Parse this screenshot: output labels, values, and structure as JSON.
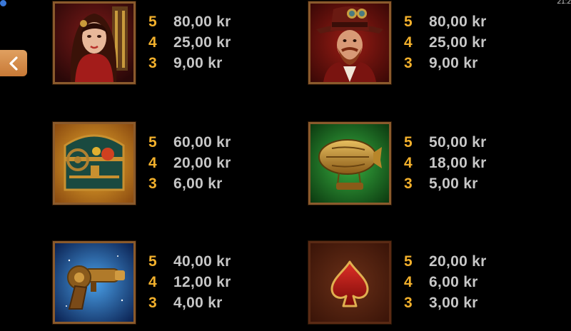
{
  "status_bar": {
    "time": "21:2"
  },
  "navigation": {
    "back_icon": "chevron-left-icon"
  },
  "theme": {
    "count_color": "#f2b02c",
    "amount_color": "#c6c6c6",
    "frame_color": "#8a5a2c",
    "back_button_color": "#d08a48"
  },
  "paytable": [
    {
      "symbol": "woman-character",
      "payouts": [
        {
          "count": "5",
          "amount": "80,00 kr"
        },
        {
          "count": "4",
          "amount": "25,00 kr"
        },
        {
          "count": "3",
          "amount": "9,00 kr"
        }
      ]
    },
    {
      "symbol": "man-character",
      "payouts": [
        {
          "count": "5",
          "amount": "80,00 kr"
        },
        {
          "count": "4",
          "amount": "25,00 kr"
        },
        {
          "count": "3",
          "amount": "9,00 kr"
        }
      ]
    },
    {
      "symbol": "treasure-chest",
      "payouts": [
        {
          "count": "5",
          "amount": "60,00 kr"
        },
        {
          "count": "4",
          "amount": "20,00 kr"
        },
        {
          "count": "3",
          "amount": "6,00 kr"
        }
      ]
    },
    {
      "symbol": "airship",
      "payouts": [
        {
          "count": "5",
          "amount": "50,00 kr"
        },
        {
          "count": "4",
          "amount": "18,00 kr"
        },
        {
          "count": "3",
          "amount": "5,00 kr"
        }
      ]
    },
    {
      "symbol": "ray-gun",
      "payouts": [
        {
          "count": "5",
          "amount": "40,00 kr"
        },
        {
          "count": "4",
          "amount": "12,00 kr"
        },
        {
          "count": "3",
          "amount": "4,00 kr"
        }
      ]
    },
    {
      "symbol": "spade",
      "payouts": [
        {
          "count": "5",
          "amount": "20,00 kr"
        },
        {
          "count": "4",
          "amount": "6,00 kr"
        },
        {
          "count": "3",
          "amount": "3,00 kr"
        }
      ]
    }
  ]
}
